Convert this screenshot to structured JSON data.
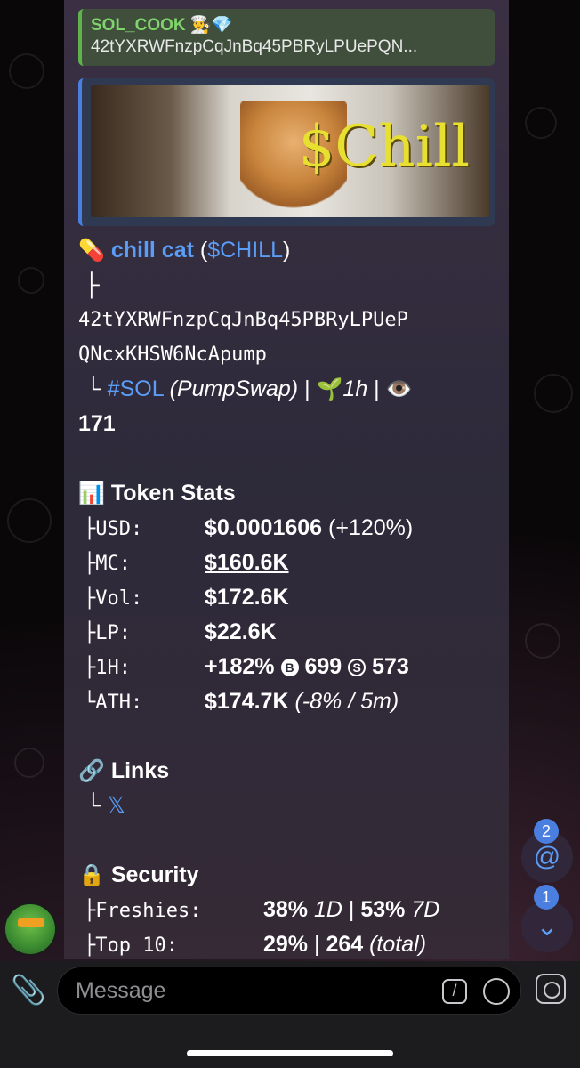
{
  "reply": {
    "name": "SOL_COOK 👨‍🍳💎",
    "text": "42tYXRWFnzpCqJnBq45PBRyLPUePQN..."
  },
  "preview": {
    "image_text": "$Chill"
  },
  "token": {
    "pill": "💊",
    "name": "chill cat",
    "ticker_open": " (",
    "ticker": "$CHILL",
    "ticker_close": ")",
    "tree_top": "├",
    "address_line1": "42tYXRWFnzpCqJnBq45PBRyLPUeP",
    "address_line2": "QNcxKHSW6NcApump",
    "tree_end": "└",
    "chain": "#SOL",
    "dex": "(PumpSwap)",
    "sep1": " | ",
    "age_icon": "🌱",
    "age": "1h",
    "sep2": " | ",
    "views_icon": "👁️",
    "views": "171"
  },
  "stats": {
    "icon": "📊",
    "heading": "Token Stats",
    "rows": [
      {
        "prefix": "├",
        "label": "USD:",
        "value": "$0.0001606",
        "extra": " (+120%)"
      },
      {
        "prefix": "├",
        "label": "MC:",
        "value": "$160.6K",
        "extra": ""
      },
      {
        "prefix": "├",
        "label": "Vol:",
        "value": "$172.6K",
        "extra": ""
      },
      {
        "prefix": "├",
        "label": "LP:",
        "value": "$22.6K",
        "extra": ""
      }
    ],
    "h1": {
      "prefix": "├",
      "label": "1H:",
      "value": "+182%",
      "buy_icon": "B",
      "buys": "699",
      "sell_icon": "S",
      "sells": "573"
    },
    "ath": {
      "prefix": "└",
      "label": "ATH:",
      "value": "$174.7K",
      "extra": "(-8% / 5m)"
    }
  },
  "links": {
    "icon": "🔗",
    "heading": "Links",
    "prefix": "└",
    "x_icon": "𝕏"
  },
  "security": {
    "icon": "🔒",
    "heading": "Security",
    "freshies": {
      "prefix": "├",
      "label": "Freshies:",
      "v1": "38%",
      "p1": "1D",
      "sep": " | ",
      "v2": "53%",
      "p2": "7D"
    },
    "top10": {
      "prefix": "├",
      "label": "Top 10:",
      "v1": "29%",
      "sep": " | ",
      "v2": "264",
      "extra": "(total)"
    }
  },
  "fabs": {
    "mention_icon": "@",
    "mention_count": "2",
    "down_icon": "⌄",
    "down_count": "1"
  },
  "input": {
    "placeholder": "Message",
    "attach_icon": "📎",
    "cmd_icon": "/"
  }
}
